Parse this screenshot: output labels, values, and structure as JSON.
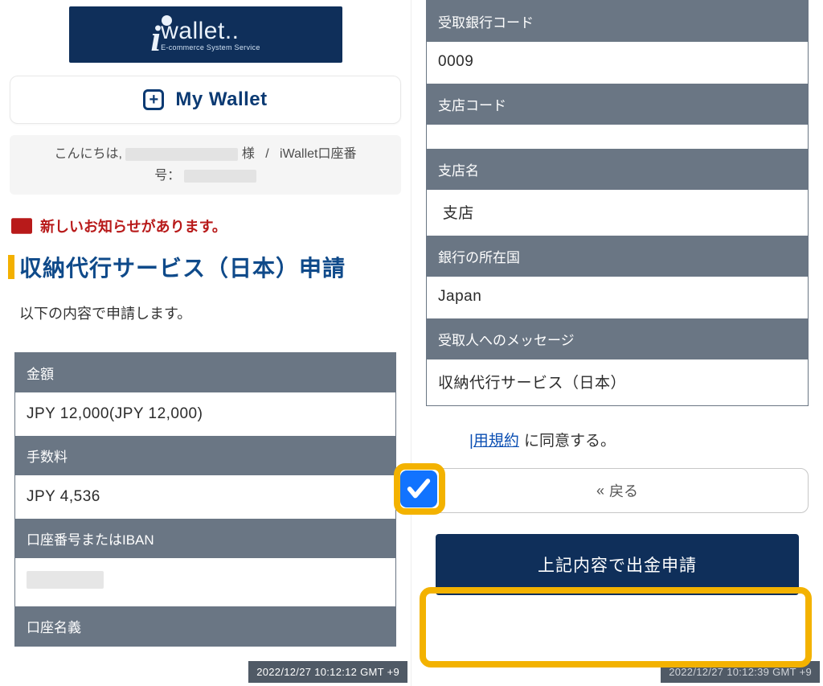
{
  "logo": {
    "brand_i": "i",
    "brand_text": "wallet..",
    "brand_sub": "E-commerce System Service"
  },
  "mywallet": {
    "label": "My Wallet"
  },
  "greeting": {
    "hello": "こんにちは,",
    "sama": "様",
    "slash": "/",
    "acct_label": "iWallet口座番",
    "acct_label2": "号："
  },
  "notice": {
    "text": "新しいお知らせがあります。"
  },
  "title": {
    "text": "収納代行サービス（日本）申請"
  },
  "subnote": {
    "text": "以下の内容で申請します。"
  },
  "left_table": {
    "amount_label": "金額",
    "amount_value": "JPY 12,000(JPY 12,000)",
    "fee_label": "手数料",
    "fee_value": "JPY 4,536",
    "iban_label": "口座番号またはIBAN",
    "holder_label": "口座名義"
  },
  "right_table": {
    "bankcode_label": "受取銀行コード",
    "bankcode_value": "0009",
    "branchcode_label": "支店コード",
    "branchname_label": "支店名",
    "branchname_suffix": "支店",
    "country_label": "銀行の所在国",
    "country_value": "Japan",
    "msg_label": "受取人へのメッセージ",
    "msg_value": "収納代行サービス（日本）"
  },
  "consent": {
    "link_text": "|用規約",
    "suffix": "に同意する。"
  },
  "back": {
    "label": "戻る",
    "chev": "«"
  },
  "submit": {
    "label": "上記内容で出金申請"
  },
  "timestamp_left": "2022/12/27 10:12:12 GMT +9",
  "timestamp_right": "2022/12/27 10:12:39 GMT +9"
}
